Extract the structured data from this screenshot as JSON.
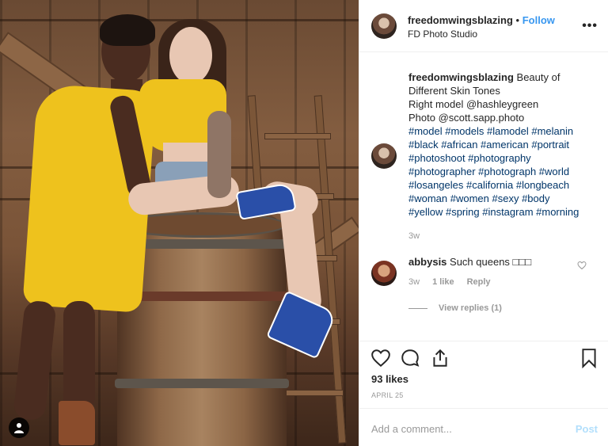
{
  "post": {
    "username": "freedomwingsblazing",
    "follow_label": "Follow",
    "separator": "•",
    "location": "FD Photo Studio",
    "more_label": "•••"
  },
  "caption": {
    "username": "freedomwingsblazing",
    "line1": " Beauty of",
    "line2": "Different Skin Tones",
    "line3": "Right model @hashleygreen",
    "line4": "Photo @scott.sapp.photo",
    "hashtags": [
      "#model #models #lamodel #melanin",
      "#black #african #american #portrait",
      "#photoshoot #photography",
      "#photographer #photograph #world",
      "#losangeles #california #longbeach",
      "#woman #women #sexy #body",
      "#yellow #spring #instagram #morning"
    ],
    "time": "3w"
  },
  "comment": {
    "username": "abbysis",
    "text": " Such queens □□□",
    "time": "3w",
    "likes": "1 like",
    "reply": "Reply",
    "view_replies": "View replies (1)"
  },
  "stats": {
    "likes": "93 likes",
    "date": "APRIL 25"
  },
  "input": {
    "placeholder": "Add a comment...",
    "post_label": "Post"
  },
  "icons": {
    "like": "heart-icon",
    "comment": "comment-icon",
    "share": "share-icon",
    "save": "bookmark-icon",
    "user_tag": "person-icon"
  },
  "colors": {
    "link": "#3897f0",
    "hashtag": "#003569",
    "muted": "#999999",
    "post_disabled": "#b2dffc"
  }
}
